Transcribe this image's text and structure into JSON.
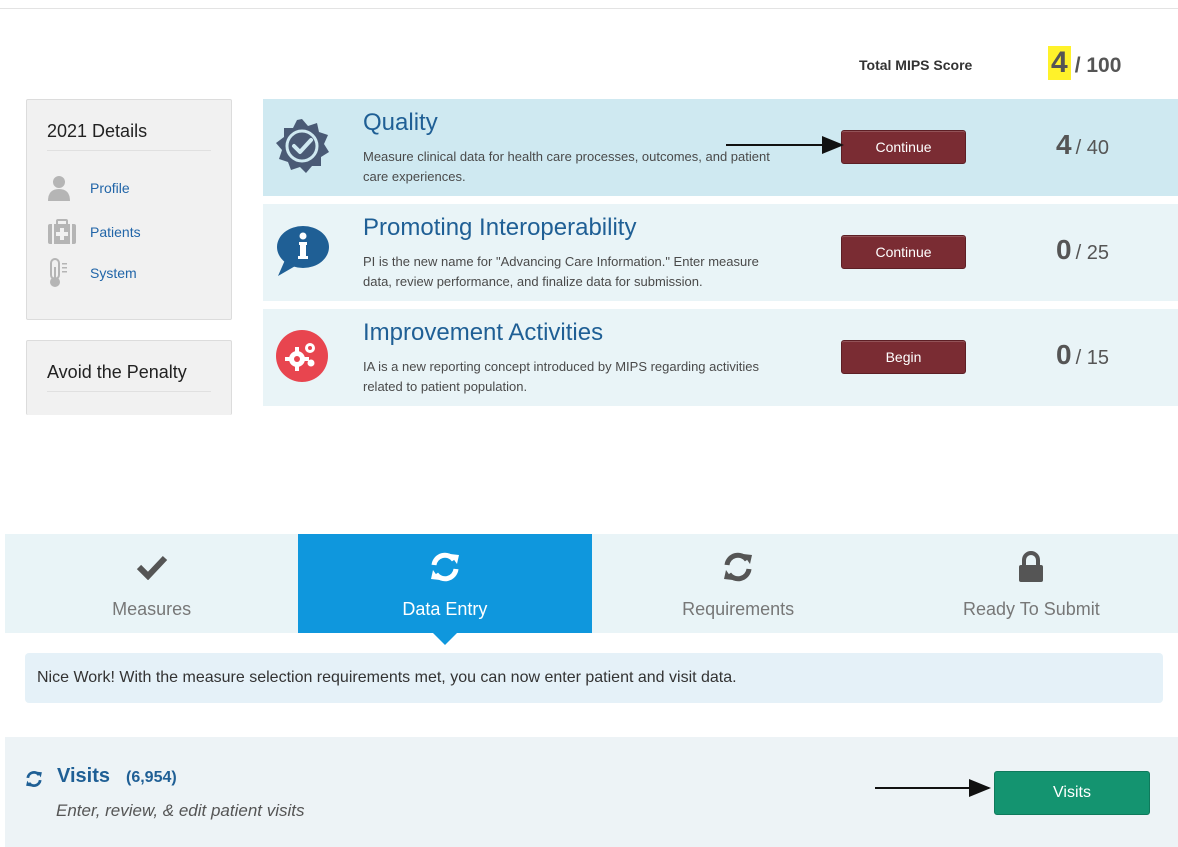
{
  "total": {
    "label": "Total MIPS Score",
    "score": "4",
    "max": "/ 100"
  },
  "sidebar": {
    "details_title": "2021 Details",
    "items": [
      {
        "label": "Profile",
        "icon": "person-icon"
      },
      {
        "label": "Patients",
        "icon": "medical-kit-icon"
      },
      {
        "label": "System",
        "icon": "thermometer-icon"
      }
    ],
    "penalty_title": "Avoid the Penalty"
  },
  "categories": [
    {
      "title": "Quality",
      "description": "Measure clinical data for health care processes, outcomes, and patient care experiences.",
      "button": "Continue",
      "score": "4",
      "max": "/ 40",
      "icon": "badge-check-icon",
      "icon_color": "#4a5a75"
    },
    {
      "title": "Promoting Interoperability",
      "description": "PI is the new name for \"Advancing Care Information.\" Enter measure data, review performance, and finalize data for submission.",
      "button": "Continue",
      "score": "0",
      "max": "/ 25",
      "icon": "info-speech-bubble-icon",
      "icon_color": "#1f5f95"
    },
    {
      "title": "Improvement Activities",
      "description": "IA is a new reporting concept introduced by MIPS regarding activities related to patient population.",
      "button": "Begin",
      "score": "0",
      "max": "/ 15",
      "icon": "gears-icon",
      "icon_color": "#e8454f"
    }
  ],
  "steps": [
    {
      "label": "Measures",
      "icon": "checkmark-icon"
    },
    {
      "label": "Data Entry",
      "icon": "refresh-icon",
      "active": true
    },
    {
      "label": "Requirements",
      "icon": "refresh-icon"
    },
    {
      "label": "Ready To Submit",
      "icon": "lock-icon"
    }
  ],
  "notice": "Nice Work! With the measure selection requirements met, you can now enter patient and visit data.",
  "visits": {
    "title": "Visits",
    "count": "(6,954)",
    "description": "Enter, review, & edit patient visits",
    "button": "Visits",
    "icon": "refresh-icon"
  },
  "colors": {
    "accent_blue": "#0f97dd",
    "title_blue": "#1f5f95",
    "button_maroon": "#7a2c33",
    "button_green": "#149470",
    "highlight_yellow": "#fff22a"
  }
}
